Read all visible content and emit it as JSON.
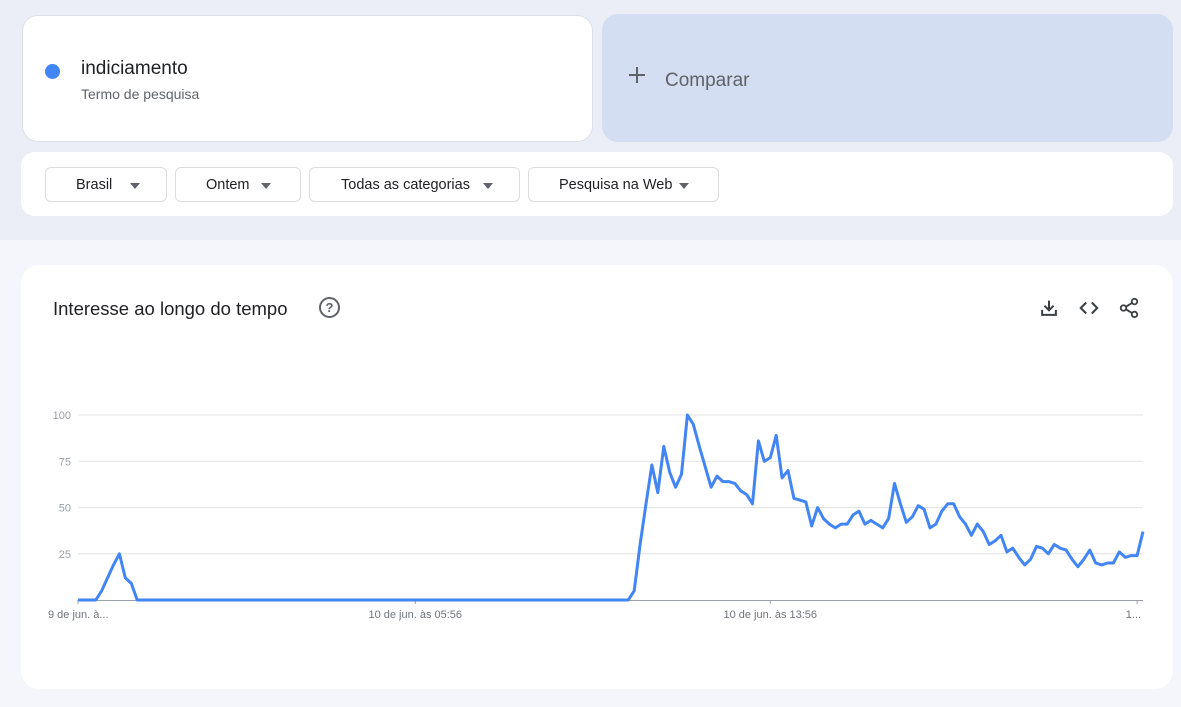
{
  "term": {
    "name": "indiciamento",
    "type": "Termo de pesquisa",
    "color": "#4285f4"
  },
  "compare": {
    "label": "Comparar"
  },
  "filters": [
    {
      "label": "Brasil"
    },
    {
      "label": "Ontem"
    },
    {
      "label": "Todas as categorias"
    },
    {
      "label": "Pesquisa na Web"
    }
  ],
  "chart": {
    "title": "Interesse ao longo do tempo",
    "help": "?",
    "icons": [
      "download-icon",
      "embed-code-icon",
      "share-icon"
    ]
  },
  "chart_data": {
    "type": "line",
    "title": "Interesse ao longo do tempo",
    "ylim": [
      0,
      100
    ],
    "yticks": [
      100,
      75,
      50,
      25
    ],
    "xticks": [
      {
        "label": "9 de jun. à...",
        "index": 0
      },
      {
        "label": "10 de jun. às 05:56",
        "index": 57
      },
      {
        "label": "10 de jun. às 13:56",
        "index": 117
      },
      {
        "label": "1...",
        "index": 179
      }
    ],
    "grid": true,
    "series": [
      {
        "name": "indiciamento",
        "color": "#4285f4",
        "values": [
          0,
          0,
          0,
          0,
          5,
          12,
          19,
          25,
          12,
          9,
          0,
          0,
          0,
          0,
          0,
          0,
          0,
          0,
          0,
          0,
          0,
          0,
          0,
          0,
          0,
          0,
          0,
          0,
          0,
          0,
          0,
          0,
          0,
          0,
          0,
          0,
          0,
          0,
          0,
          0,
          0,
          0,
          0,
          0,
          0,
          0,
          0,
          0,
          0,
          0,
          0,
          0,
          0,
          0,
          0,
          0,
          0,
          0,
          0,
          0,
          0,
          0,
          0,
          0,
          0,
          0,
          0,
          0,
          0,
          0,
          0,
          0,
          0,
          0,
          0,
          0,
          0,
          0,
          0,
          0,
          0,
          0,
          0,
          0,
          0,
          0,
          0,
          0,
          0,
          0,
          0,
          0,
          0,
          0,
          5,
          30,
          52,
          73,
          58,
          83,
          69,
          61,
          68,
          100,
          95,
          83,
          72,
          61,
          67,
          64,
          64,
          63,
          59,
          57,
          52,
          86,
          75,
          77,
          89,
          66,
          70,
          55,
          54,
          53,
          40,
          50,
          44,
          41,
          39,
          41,
          41,
          46,
          48,
          41,
          43,
          41,
          39,
          44,
          63,
          52,
          42,
          45,
          51,
          49,
          39,
          41,
          48,
          52,
          52,
          45,
          41,
          35,
          41,
          37,
          30,
          32,
          35,
          26,
          28,
          23,
          19,
          22,
          29,
          28,
          25,
          30,
          28,
          27,
          22,
          18,
          22,
          27,
          20,
          19,
          20,
          20,
          26,
          23,
          24,
          24,
          37
        ]
      }
    ]
  }
}
